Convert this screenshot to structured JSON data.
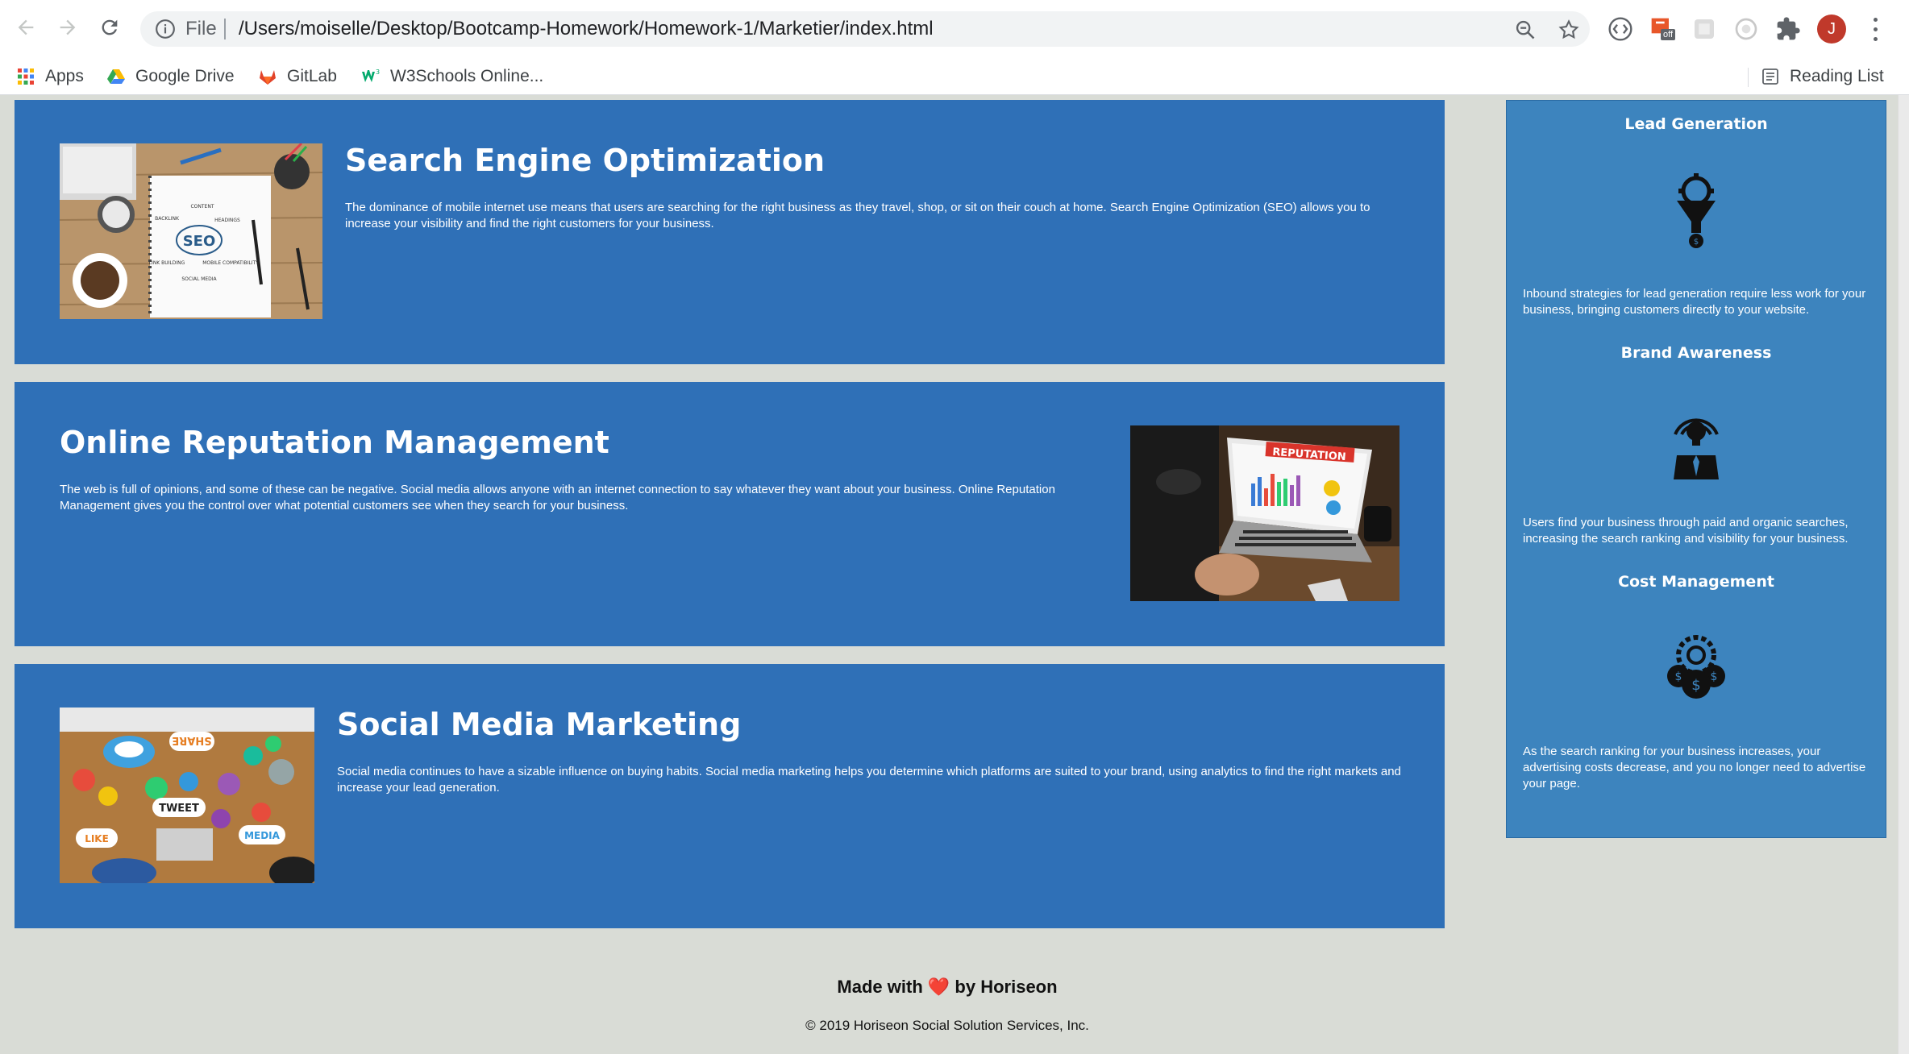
{
  "browser": {
    "url_scheme_label": "File",
    "url": "/Users/moiselle/Desktop/Bootcamp-Homework/Homework-1/Marketier/index.html",
    "profile_initial": "J",
    "bookmarks": [
      {
        "label": "Apps",
        "icon": "apps-grid-icon"
      },
      {
        "label": "Google Drive",
        "icon": "google-drive-icon"
      },
      {
        "label": "GitLab",
        "icon": "gitlab-icon"
      },
      {
        "label": "W3Schools Online...",
        "icon": "w3schools-icon"
      }
    ],
    "reading_list_label": "Reading List",
    "extension_badge": "off"
  },
  "sections": [
    {
      "title": "Search Engine Optimization",
      "text": "The dominance of mobile internet use means that users are searching for the right business as they travel, shop, or sit on their couch at home. Search Engine Optimization (SEO) allows you to increase your visibility and find the right customers for your business.",
      "image_labels": {
        "main": "SEO",
        "a": "CONTENT",
        "b": "BACKLINK",
        "c": "HEADINGS",
        "d": "LINK BUILDING",
        "e": "MOBILE COMPATIBILITY",
        "f": "SOCIAL MEDIA"
      }
    },
    {
      "title": "Online Reputation Management",
      "text": "The web is full of opinions, and some of these can be negative. Social media allows anyone with an internet connection to say whatever they want about your business. Online Reputation Management gives you the control over what potential customers see when they search for your business.",
      "image_labels": {
        "main": "REPUTATION"
      }
    },
    {
      "title": "Social Media Marketing",
      "text": "Social media continues to have a sizable influence on buying habits. Social media marketing helps you determine which platforms are suited to your brand, using analytics to find the right markets and increase your lead generation.",
      "image_labels": {
        "a": "SHARE",
        "b": "TWEET",
        "c": "LIKE",
        "d": "MEDIA"
      }
    }
  ],
  "benefits": [
    {
      "title": "Lead Generation",
      "icon": "lead-funnel-icon",
      "text": "Inbound strategies for lead generation require less work for your business, bringing customers directly to your website."
    },
    {
      "title": "Brand Awareness",
      "icon": "brand-lightbulb-icon",
      "text": "Users find your business through paid and organic searches, increasing the search ranking and visibility for your business."
    },
    {
      "title": "Cost Management",
      "icon": "cost-gears-icon",
      "text": "As the search ranking for your business increases, your advertising costs decrease, and you no longer need to advertise your page."
    }
  ],
  "footer": {
    "made_prefix": "Made with",
    "made_suffix": "by Horiseon",
    "heart": "❤️",
    "copyright": "© 2019 Horiseon Social Solution Services, Inc."
  },
  "colors": {
    "card_blue": "#2f70b7",
    "aside_blue": "#3d84be",
    "page_bg": "#d9dcd6"
  }
}
